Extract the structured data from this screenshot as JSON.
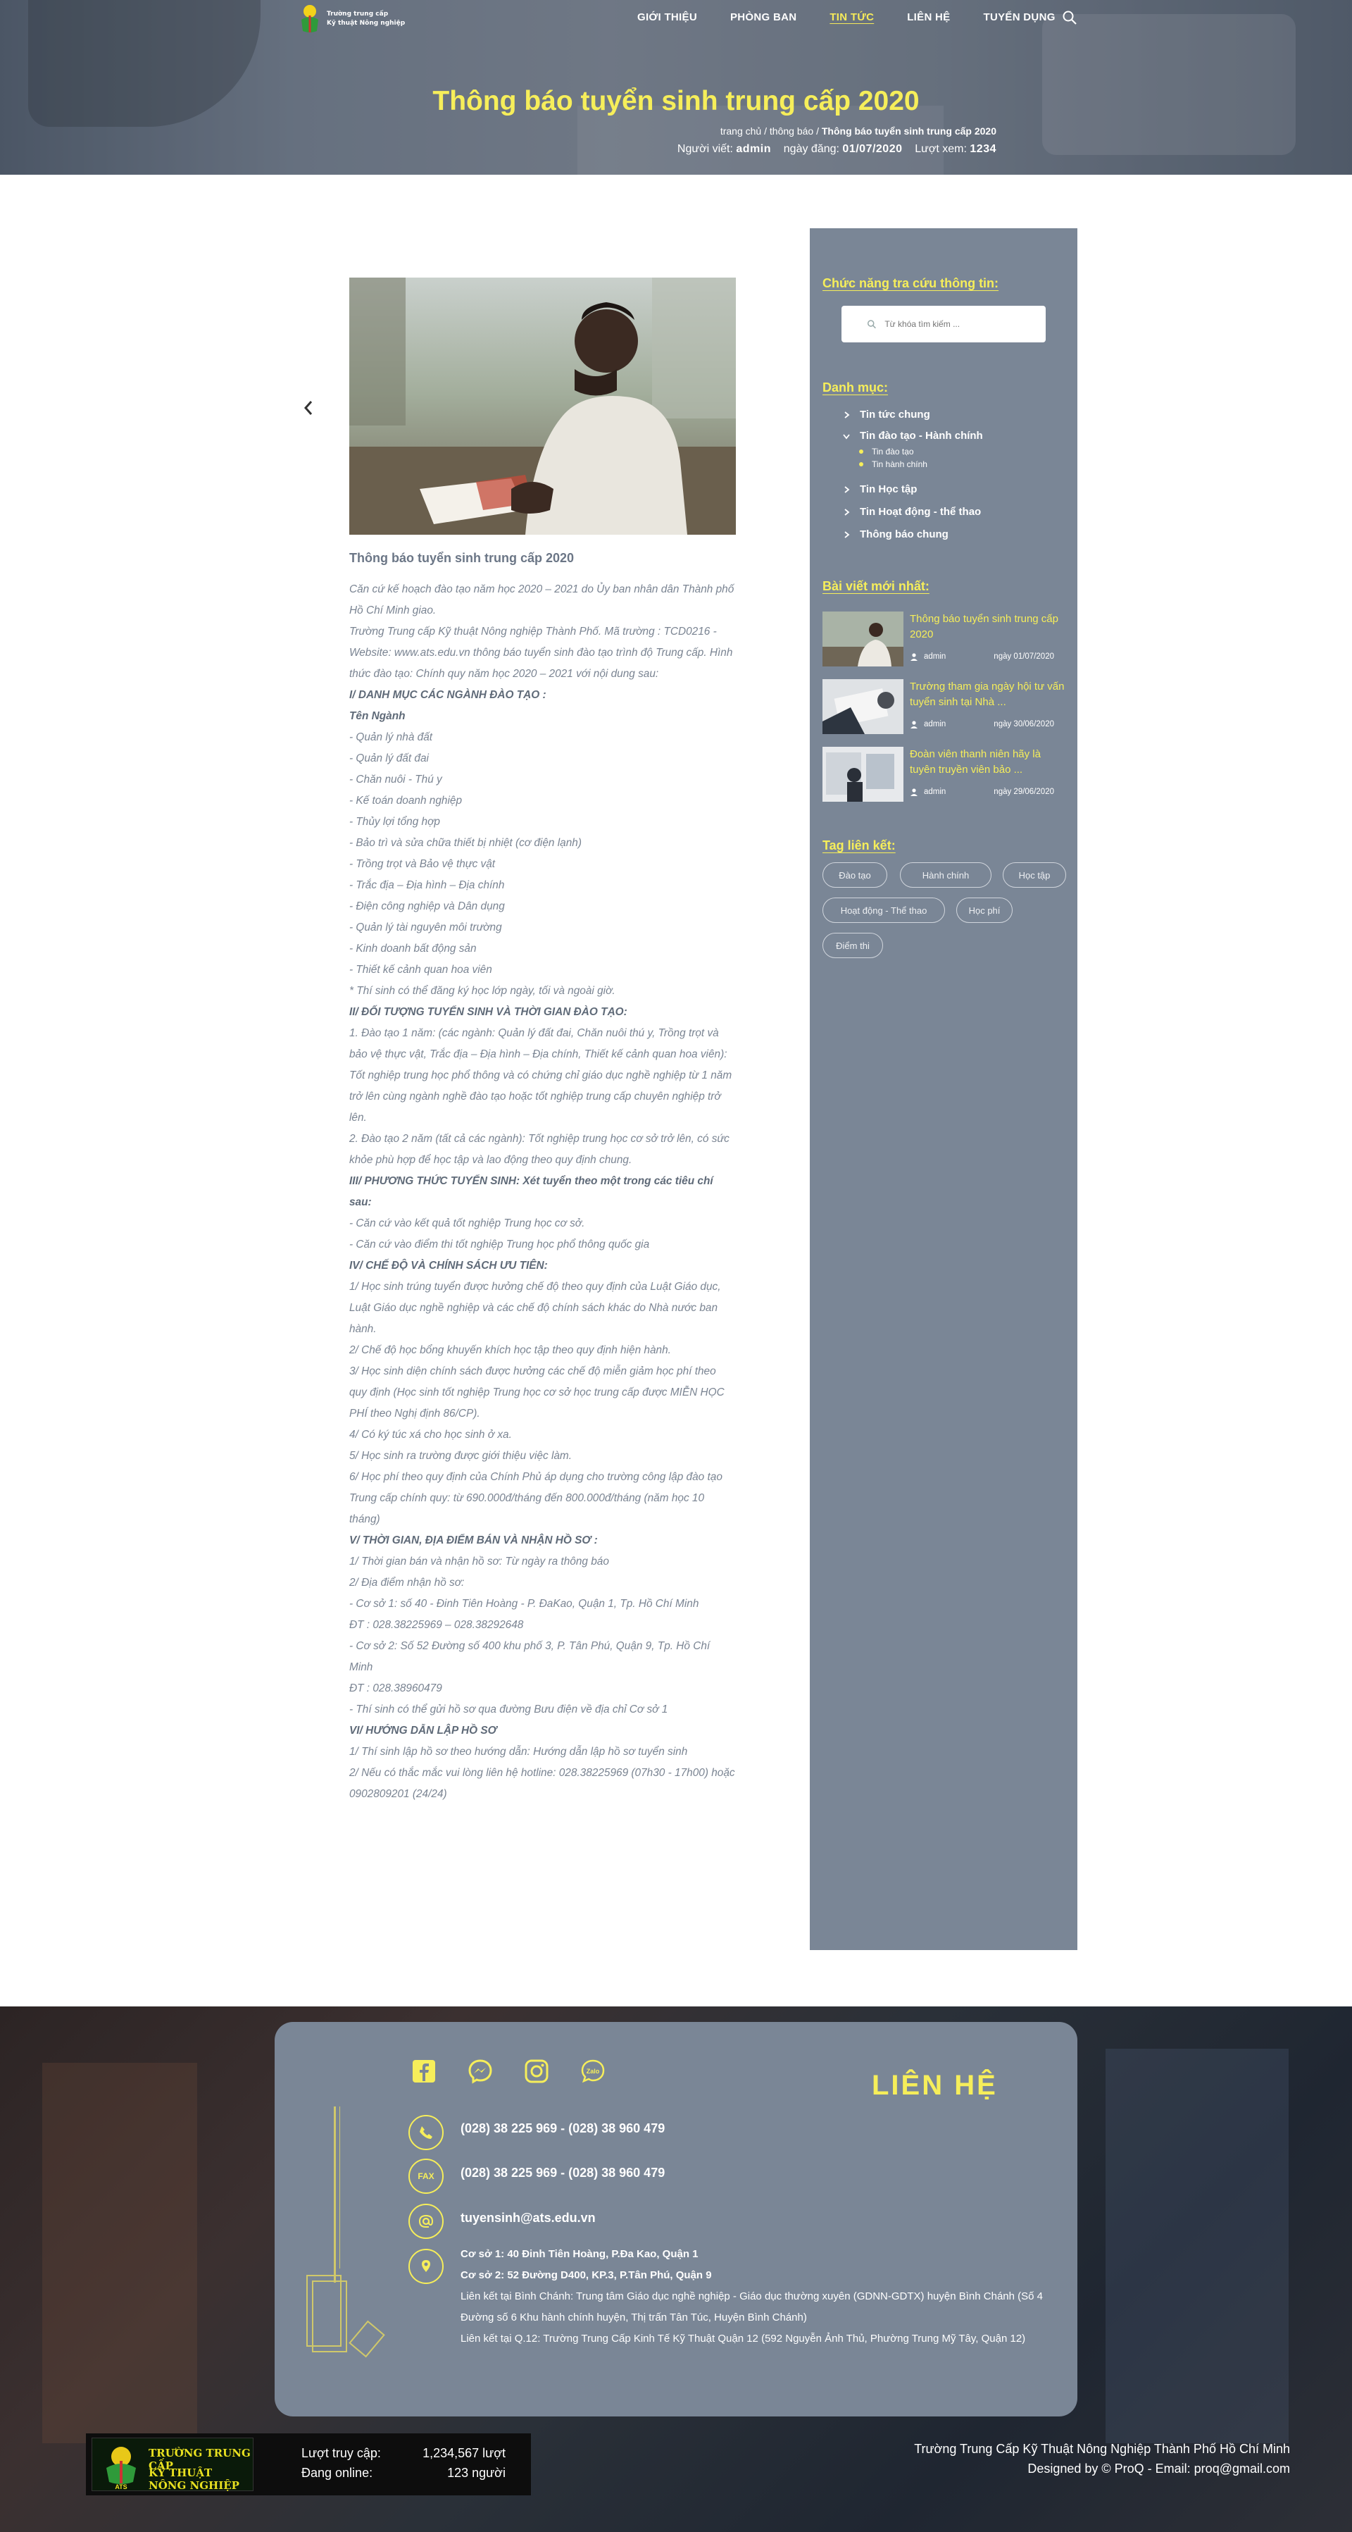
{
  "header": {
    "logo": {
      "line1": "Trường trung cấp",
      "line2": "Kỹ thuật Nông nghiệp"
    },
    "nav": [
      "GIỚI THIỆU",
      "PHÒNG BAN",
      "TIN TỨC",
      "LIÊN HỆ",
      "TUYỂN DỤNG"
    ],
    "active_nav": "TIN TỨC",
    "title": "Thông báo tuyển sinh trung cấp 2020",
    "breadcrumb": {
      "home": "trang chủ",
      "sep": " / ",
      "section": "thông báo",
      "current": "Thông báo tuyển sinh trung cấp 2020"
    },
    "meta": {
      "author_label": "Người viết:",
      "author": "admin",
      "date_label": "ngày đăng:",
      "date": "01/07/2020",
      "views_label": "Lượt xem:",
      "views": "1234"
    }
  },
  "article": {
    "title": "Thông báo tuyển sinh trung cấp 2020",
    "paragraphs": [
      {
        "t": "Căn cứ kế hoạch đào tạo năm học 2020 – 2021 do Ủy ban nhân dân Thành phố Hồ Chí Minh giao.",
        "h": false
      },
      {
        "t": "Trường Trung cấp Kỹ thuật Nông nghiệp Thành Phố. Mã trường : TCD0216 - Website: www.ats.edu.vn thông báo tuyển sinh đào tạo trình độ Trung cấp. Hình thức đào tạo: Chính quy năm học 2020 – 2021 với nội dung sau:",
        "h": false
      },
      {
        "t": "I/ DANH MỤC CÁC NGÀNH ĐÀO TẠO :",
        "h": true
      },
      {
        "t": "Tên Ngành",
        "h": true
      },
      {
        "t": "- Quản lý nhà đất",
        "h": false
      },
      {
        "t": "- Quản lý đất đai",
        "h": false
      },
      {
        "t": "- Chăn nuôi - Thú y",
        "h": false
      },
      {
        "t": "- Kế toán doanh nghiệp",
        "h": false
      },
      {
        "t": "- Thủy lợi tổng hợp",
        "h": false
      },
      {
        "t": "- Bảo trì và sửa chữa thiết bị nhiệt (cơ điện lạnh)",
        "h": false
      },
      {
        "t": "- Trồng trọt và Bảo vệ thực vật",
        "h": false
      },
      {
        "t": "- Trắc địa – Địa hình – Địa chính",
        "h": false
      },
      {
        "t": "- Điện công nghiệp và Dân dụng",
        "h": false
      },
      {
        "t": "- Quản lý tài nguyên môi trường",
        "h": false
      },
      {
        "t": "- Kinh doanh bất động sản",
        "h": false
      },
      {
        "t": "- Thiết kế cảnh quan hoa viên",
        "h": false
      },
      {
        "t": "*  Thí sinh có thể đăng ký học lớp ngày, tối và ngoài giờ.",
        "h": false
      },
      {
        "t": "II/ ĐỐI TƯỢNG TUYỂN SINH VÀ THỜI GIAN ĐÀO TẠO:",
        "h": true
      },
      {
        "t": " 1. Đào tạo 1 năm: (các ngành: Quản lý đất đai, Chăn nuôi thú y, Trồng trọt và bảo vệ thực vật, Trắc địa – Địa hình – Địa chính, Thiết kế cảnh quan hoa viên): Tốt nghiệp trung học phổ thông và có chứng chỉ giáo dục nghề nghiệp từ 1 năm trở lên cùng ngành nghề đào tạo hoặc tốt nghiệp trung cấp chuyên nghiệp trở lên.",
        "h": false
      },
      {
        "t": "2. Đào tạo 2 năm (tất cả các ngành): Tốt nghiệp trung học cơ sở trở lên, có sức khỏe phù hợp để học tập và lao động theo quy định chung.",
        "h": false
      },
      {
        "t": " III/ PHƯƠNG THỨC TUYỂN SINH: Xét tuyển theo một trong các tiêu chí sau:",
        "h": true
      },
      {
        "t": "- Căn cứ vào kết quả tốt nghiệp Trung học cơ sở.",
        "h": false
      },
      {
        "t": "- Căn cứ vào điểm thi tốt nghiệp Trung học phổ thông quốc gia",
        "h": false
      },
      {
        "t": "IV/ CHẾ ĐỘ VÀ CHÍNH SÁCH ƯU TIÊN:",
        "h": true
      },
      {
        "t": "1/ Học sinh trúng tuyển được hưởng chế độ theo quy định của Luật Giáo dục, Luật Giáo dục nghề nghiệp và các chế độ chính sách khác do Nhà nước ban hành.",
        "h": false
      },
      {
        "t": "2/ Chế độ học bổng khuyến khích học tập theo quy định hiện hành.",
        "h": false
      },
      {
        "t": "3/ Học sinh diện chính sách được hưởng các chế độ miễn giảm học phí theo quy định (Học sinh tốt nghiệp Trung học cơ sở học trung cấp được MIỄN HỌC PHÍ theo Nghị định 86/CP).",
        "h": false
      },
      {
        "t": "4/ Có ký túc xá cho học sinh ở xa.",
        "h": false
      },
      {
        "t": "5/ Học sinh ra trường được giới thiệu việc làm.",
        "h": false
      },
      {
        "t": "6/ Học phí theo quy định của Chính Phủ áp dụng cho trường công lập đào tạo Trung cấp chính quy: từ 690.000đ/tháng đến 800.000đ/tháng (năm học 10 tháng)",
        "h": false
      },
      {
        "t": "V/ THỜI GIAN, ĐỊA ĐIỂM BÁN VÀ NHẬN HỒ SƠ :",
        "h": true
      },
      {
        "t": "1/ Thời gian bán và nhận hồ sơ: Từ ngày ra thông báo",
        "h": false
      },
      {
        "t": "2/ Địa điểm nhận hồ sơ:",
        "h": false
      },
      {
        "t": "- Cơ sở 1: số 40 - Đinh Tiên Hoàng - P. ĐaKao, Quận 1, Tp. Hồ Chí Minh",
        "h": false
      },
      {
        "t": "ĐT : 028.38225969 – 028.38292648",
        "h": false
      },
      {
        "t": "- Cơ sở 2: Số 52 Đường số 400 khu phố 3, P. Tân Phú, Quận 9, Tp. Hồ Chí Minh",
        "h": false
      },
      {
        "t": "ĐT : 028.38960479",
        "h": false
      },
      {
        "t": "- Thí sinh có thể gửi hồ sơ qua đường Bưu điện về địa chỉ Cơ sở 1",
        "h": false
      },
      {
        "t": "VI/ HƯỚNG DẪN LẬP HỒ SƠ",
        "h": true
      },
      {
        "t": "1/ Thí sinh lập hồ sơ theo hướng dẫn: Hướng dẫn lập hồ sơ tuyển sinh",
        "h": false
      },
      {
        "t": "2/ Nếu có thắc mắc vui lòng liên hệ hotline: 028.38225969 (07h30 - 17h00) hoặc 0902809201 (24/24)",
        "h": false
      }
    ]
  },
  "sidebar": {
    "lookup_heading": "Chức năng tra cứu thông tin:",
    "search_placeholder": "Từ khóa tìm kiếm ...",
    "category_heading": "Danh mục:",
    "categories": [
      {
        "label": "Tin tức chung",
        "expanded": false
      },
      {
        "label": "Tin đào tạo - Hành chính",
        "expanded": true,
        "children": [
          "Tin đào tạo",
          "Tin hành chính"
        ]
      },
      {
        "label": "Tin Học tập",
        "expanded": false
      },
      {
        "label": "Tin Hoạt động - thể thao",
        "expanded": false
      },
      {
        "label": "Thông báo chung",
        "expanded": false
      }
    ],
    "recent_heading": "Bài viết mới nhất:",
    "recent_posts": [
      {
        "title": "Thông báo tuyển sinh trung cấp 2020",
        "author": "admin",
        "date": "ngày 01/07/2020"
      },
      {
        "title": "Trường tham gia ngày hội tư vấn tuyển sinh tại Nhà ...",
        "author": "admin",
        "date": "ngày 30/06/2020"
      },
      {
        "title": "Đoàn viên thanh niên hãy là tuyên truyền viên bảo ...",
        "author": "admin",
        "date": "ngày 29/06/2020"
      }
    ],
    "tags_heading": "Tag liên kết:",
    "tags": [
      "Đào tạo",
      "Hành chính",
      "Học tập",
      "Hoạt động - Thể thao",
      "Học phí",
      "Điểm thi"
    ]
  },
  "footer": {
    "social_icons": [
      "facebook-icon",
      "messenger-icon",
      "instagram-icon",
      "zalo-icon"
    ],
    "zalo_label": "Zalo",
    "contact_title": "LIÊN HỆ",
    "phone": "(028) 38 225 969  - (028) 38 960 479",
    "fax_label": "FAX",
    "fax": "(028) 38 225 969  - (028) 38 960 479",
    "email": "tuyensinh@ats.edu.vn",
    "addr1": "Cơ sở 1: 40 Đinh Tiên Hoàng, P.Đa Kao, Quận 1",
    "addr2": "Cơ sở 2: 52 Đường D400, KP.3, P.Tân Phú, Quận 9",
    "link1": "Liên kết tại Bình Chánh: Trung tâm Giáo dục nghề nghiệp - Giáo dục thường xuyên (GDNN-GDTX) huyện Bình Chánh (Số 4  Đường số 6 Khu hành chính huyện, Thị trấn Tân Túc, Huyện Bình Chánh)",
    "link2": "Liên kết tại Q.12: Trường Trung Cấp Kinh Tế Kỹ Thuật Quận 12 (592 Nguyễn Ảnh Thủ, Phường Trung Mỹ Tây, Quận 12)",
    "stats_logo_line1": "TRƯỜNG TRUNG CẤP",
    "stats_logo_line2": "KỸ THUẬT NÔNG NGHIỆP",
    "stats_logo_abbr": "ATS",
    "visits_label": "Lượt truy cập:",
    "visits": "1,234,567 lượt",
    "online_label": "Đang online:",
    "online": "123 người",
    "credit1": "Trường Trung Cấp Kỹ Thuật Nông Nghiệp Thành Phố Hồ Chí Minh",
    "credit2": "Designed by © ProQ - Email: proq@gmail.com"
  },
  "colors": {
    "accent": "#f6ee5a",
    "sidebar": "#7a8696",
    "text": "#7a8492"
  }
}
